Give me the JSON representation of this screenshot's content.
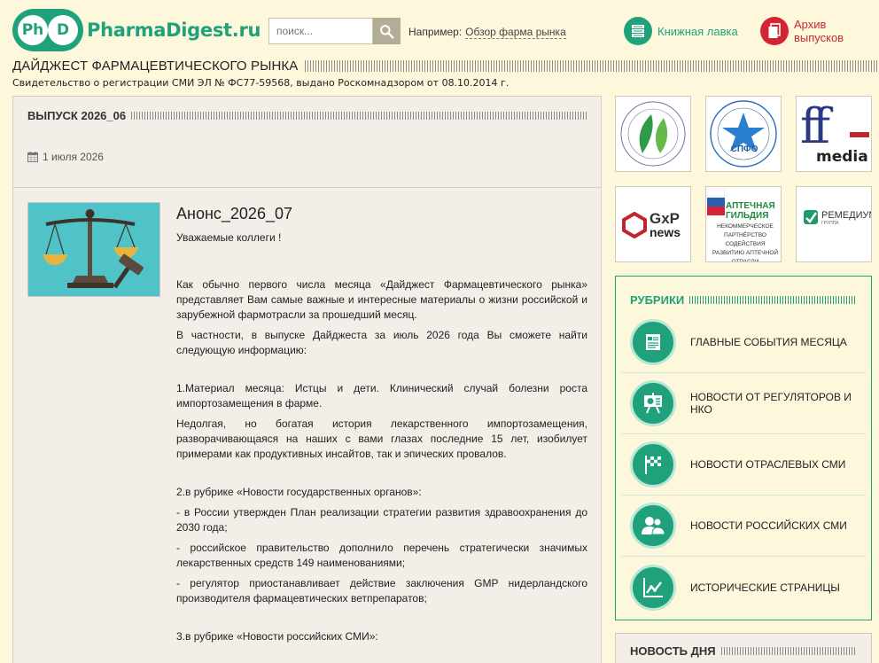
{
  "header": {
    "logo_badge": [
      "Ph",
      "D"
    ],
    "logo_text": "PharmaDigest.ru",
    "search_placeholder": "поиск...",
    "example_label": "Например:",
    "example_link": "Обзор фарма рынка",
    "shop_label": "Книжная лавка",
    "archive_label": "Архив выпусков"
  },
  "site": {
    "title": "ДАЙДЖЕСТ ФАРМАЦЕВТИЧЕСКОГО РЫНКА",
    "license": "Свидетельство о регистрации СМИ ЭЛ № ФС77-59568, выдано Роскомнадзором от 08.10.2014 г."
  },
  "issue": {
    "title": "ВЫПУСК 2026_06",
    "date": "1 июля 2026"
  },
  "article": {
    "title": "Анонс_2026_07",
    "greeting": "Уважаемые коллеги !",
    "paragraphs": [
      "Как обычно первого числа месяца «Дайджест Фармацевтического рынка» представляет Вам самые важные и интересные материалы о жизни российской и зарубежной фармотрасли за прошедший месяц.",
      "В частности, в выпуске Дайджеста за июль 2026 года Вы сможете найти следующую информацию:",
      "1.Материал месяца: Истцы и дети. Клинический случай болезни роста импортозамещения в фарме.",
      "Недолгая, но богатая история лекарственного импортозамещения, разворачивающаяся на наших с вами глазах последние 15 лет, изобилует примерами как продуктивных инсайтов, так и эпических провалов.",
      "2.в рубрике «Новости государственных органов»:",
      "- в России утвержден План реализации стратегии развития здравоохранения до 2030 года;",
      "- российское правительство дополнило перечень стратегически значимых лекарственных средств 149 наименованиями;",
      "- регулятор приостанавливает действие заключения GMP нидерландского производителя фармацевтических ветпрепаратов;",
      "3.в рубрике «Новости российских СМИ»:"
    ]
  },
  "partners": {
    "spfo": "СПФО",
    "ffmedia_ff": "ff",
    "ffmedia_word": "media",
    "gxp_top": "GxP",
    "gxp_bottom": "news",
    "guild_title": "АПТЕЧНАЯ ГИЛЬДИЯ",
    "guild_sub": "НЕКОММЕРЧЕСКОЕ ПАРТНЁРСТВО СОДЕЙСТВИЯ РАЗВИТИЮ АПТЕЧНОЙ ОТРАСЛИ",
    "remedium": "РЕМЕДИУМ",
    "remedium_sub": "ГРУППА"
  },
  "rubrics": {
    "title": "РУБРИКИ",
    "items": [
      {
        "label": "ГЛАВНЫЕ СОБЫТИЯ МЕСЯЦА",
        "icon": "document-icon"
      },
      {
        "label": "НОВОСТИ ОТ РЕГУЛЯТОРОВ И НКО",
        "icon": "presentation-icon"
      },
      {
        "label": "НОВОСТИ ОТРАСЛЕВЫХ СМИ",
        "icon": "checkered-flag-icon"
      },
      {
        "label": "НОВОСТИ РОССИЙСКИХ СМИ",
        "icon": "users-icon"
      },
      {
        "label": "ИСТОРИЧЕСКИЕ СТРАНИЦЫ",
        "icon": "line-chart-icon"
      }
    ]
  },
  "news_day": {
    "title": "НОВОСТЬ ДНЯ"
  },
  "colors": {
    "accent": "#1fa27c",
    "archive": "#d32433",
    "background": "#fdf8dc"
  }
}
